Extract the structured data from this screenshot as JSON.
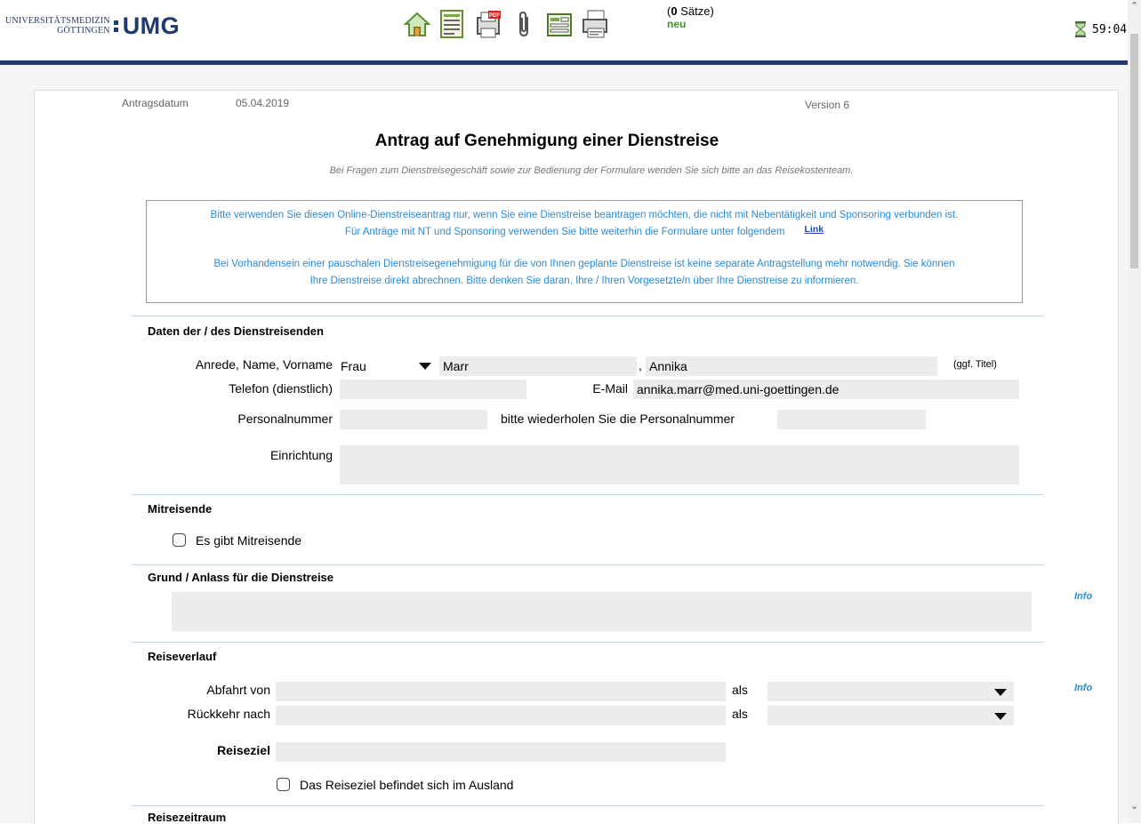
{
  "header": {
    "logo_small": "UNIVERSITÄTSMEDIZIN",
    "logo_small2": "GÖTTINGEN",
    "logo_big": "UMG",
    "records_count": "0",
    "records_label": "Sätze)",
    "records_open": "(",
    "records_status": "neu",
    "timer": "59:04",
    "colors": {
      "brand": "#1f3a6e",
      "status_green": "#3a9a2a",
      "accent_blue": "#2c8bd6"
    },
    "toolbar_icons": [
      "home-icon",
      "list-icon",
      "pdf-icon",
      "paperclip-icon",
      "form-icon",
      "print-icon"
    ]
  },
  "meta": {
    "date_label": "Antragsdatum",
    "date_value": "05.04.2019",
    "version": "Version 6"
  },
  "form": {
    "title": "Antrag auf Genehmigung einer Dienstreise",
    "subtitle": "Bei Fragen zum Dienstreisegeschäft sowie zur Bedienung der Formulare wenden Sie sich bitte an das Reisekostenteam.",
    "notice": {
      "line1": "Bitte verwenden Sie diesen Online-Dienstreiseantrag nur, wenn Sie eine Dienstreise beantragen möchten, die nicht mit Nebentätigkeit und Sponsoring verbunden ist.",
      "line2": "Für Anträge mit NT und Sponsoring verwenden Sie bitte weiterhin die Formulare unter folgendem",
      "link": "Link",
      "line3": "Bei Vorhandensein einer pauschalen Dienstreisegenehmigung für die von Ihnen geplante Dienstreise ist keine separate Antragstellung mehr notwendig. Sie können",
      "line4": "Ihre Dienstreise direkt abrechnen. Bitte denken Sie daran, Ihre / Ihren Vorgesetzte/n über Ihre Dienstreise zu informieren."
    },
    "traveler": {
      "heading": "Daten der / des Dienstreisenden",
      "name_label": "Anrede, Name, Vorname",
      "salutation": "Frau",
      "surname": "Marr",
      "comma": ",",
      "firstname": "Annika",
      "title_hint": "(ggf. Titel)",
      "phone_label": "Telefon (dienstlich)",
      "phone_value": "",
      "email_label": "E-Mail",
      "email_value": "annika.marr@med.uni-goettingen.de",
      "personnel_label": "Personalnummer",
      "personnel_value": "",
      "repeat_label": "bitte wiederholen Sie die Personalnummer",
      "repeat_value": "",
      "institution_label": "Einrichtung",
      "institution_value": ""
    },
    "companions": {
      "heading": "Mitreisende",
      "checkbox_label": "Es gibt Mitreisende",
      "checked": false
    },
    "reason": {
      "heading": "Grund / Anlass für die Dienstreise",
      "value": "",
      "info": "Info"
    },
    "route": {
      "heading": "Reiseverlauf",
      "departure_label": "Abfahrt von",
      "departure_value": "",
      "as1": "als",
      "departure_type": "",
      "return_label": "Rückkehr nach",
      "return_value": "",
      "as2": "als",
      "return_type": "",
      "destination_label": "Reiseziel",
      "destination_value": "",
      "abroad_label": "Das Reiseziel befindet sich im Ausland",
      "abroad_checked": false,
      "info": "Info"
    },
    "period": {
      "heading": "Reisezeitraum"
    }
  }
}
